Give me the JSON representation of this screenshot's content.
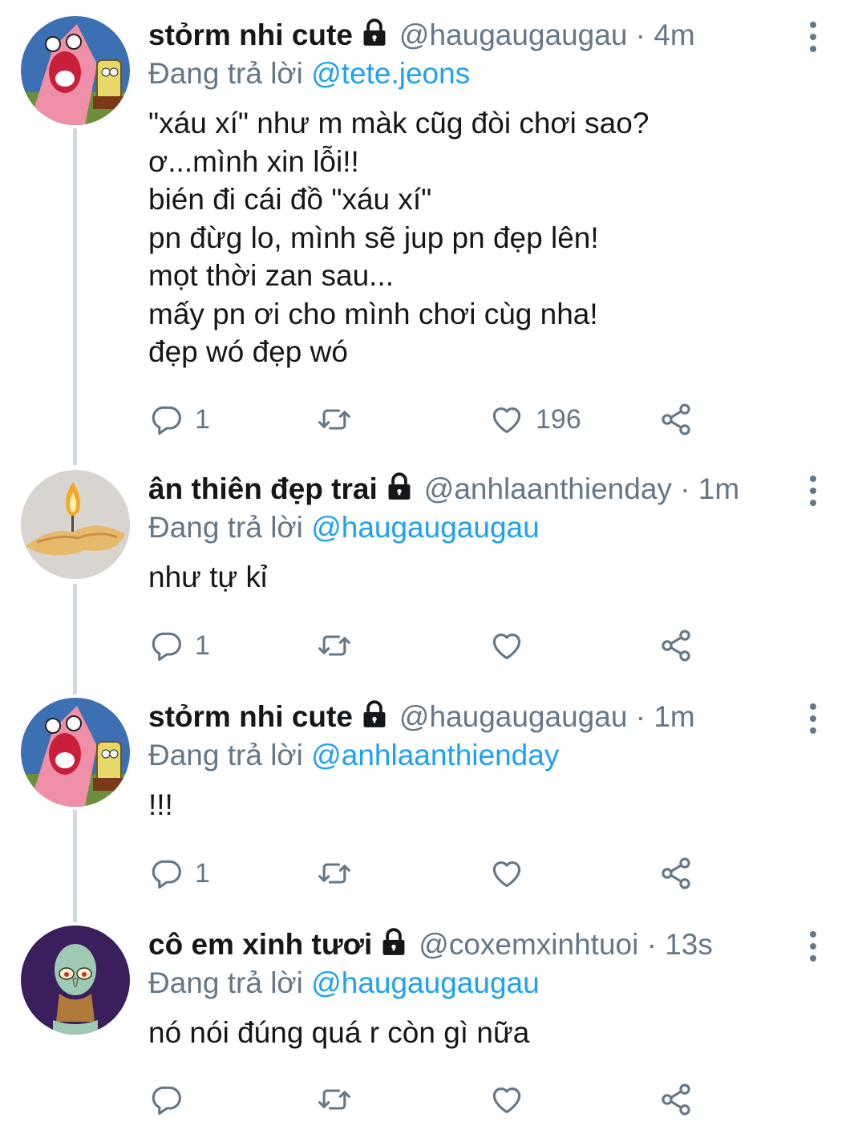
{
  "tweets": [
    {
      "avatar": "patrick-star-avatar",
      "name": "stỏrm nhi cute",
      "handle": "@haugaugaugau",
      "dot": "·",
      "time": "4m",
      "reply_prefix": "Đang trả lời",
      "reply_to": "@tete.jeons",
      "text": "\"xáu xí\" như m màk cũg đòi chơi sao?\nơ...mình xin lỗi!!\nbién đi cái đồ \"xáu xí\"\npn đừg lo, mình sẽ jup pn đẹp lên!\nmọt thời zan sau...\nmấy pn ơi cho mình chơi cùg nha!\nđẹp wó đẹp wó",
      "replies": "1",
      "retweets": "",
      "likes": "196"
    },
    {
      "avatar": "candle-flame-avatar",
      "name": "ân thiên đẹp trai",
      "handle": "@anhlaanthienday",
      "dot": "·",
      "time": "1m",
      "reply_prefix": "Đang trả lời",
      "reply_to": "@haugaugaugau",
      "text": "như tự kỉ",
      "replies": "1",
      "retweets": "",
      "likes": ""
    },
    {
      "avatar": "patrick-star-avatar",
      "name": "stỏrm nhi cute",
      "handle": "@haugaugaugau",
      "dot": "·",
      "time": "1m",
      "reply_prefix": "Đang trả lời",
      "reply_to": "@anhlaanthienday",
      "text": "!!!",
      "replies": "1",
      "retweets": "",
      "likes": ""
    },
    {
      "avatar": "squidward-avatar",
      "name": "cô em xinh tươi",
      "handle": "@coxemxinhtuoi",
      "dot": "·",
      "time": "13s",
      "reply_prefix": "Đang trả lời",
      "reply_to": "@haugaugaugau",
      "text": "nó nói đúng quá r còn gì nữa",
      "replies": "",
      "retweets": "",
      "likes": ""
    }
  ],
  "icons": {
    "lock": "lock-icon",
    "reply": "reply-icon",
    "retweet": "retweet-icon",
    "like": "heart-icon",
    "share": "share-icon",
    "more": "more-vertical-icon"
  },
  "colors": {
    "text": "#14171a",
    "secondary": "#657786",
    "link": "#1da1f2",
    "thread_line": "#cfd9de"
  }
}
